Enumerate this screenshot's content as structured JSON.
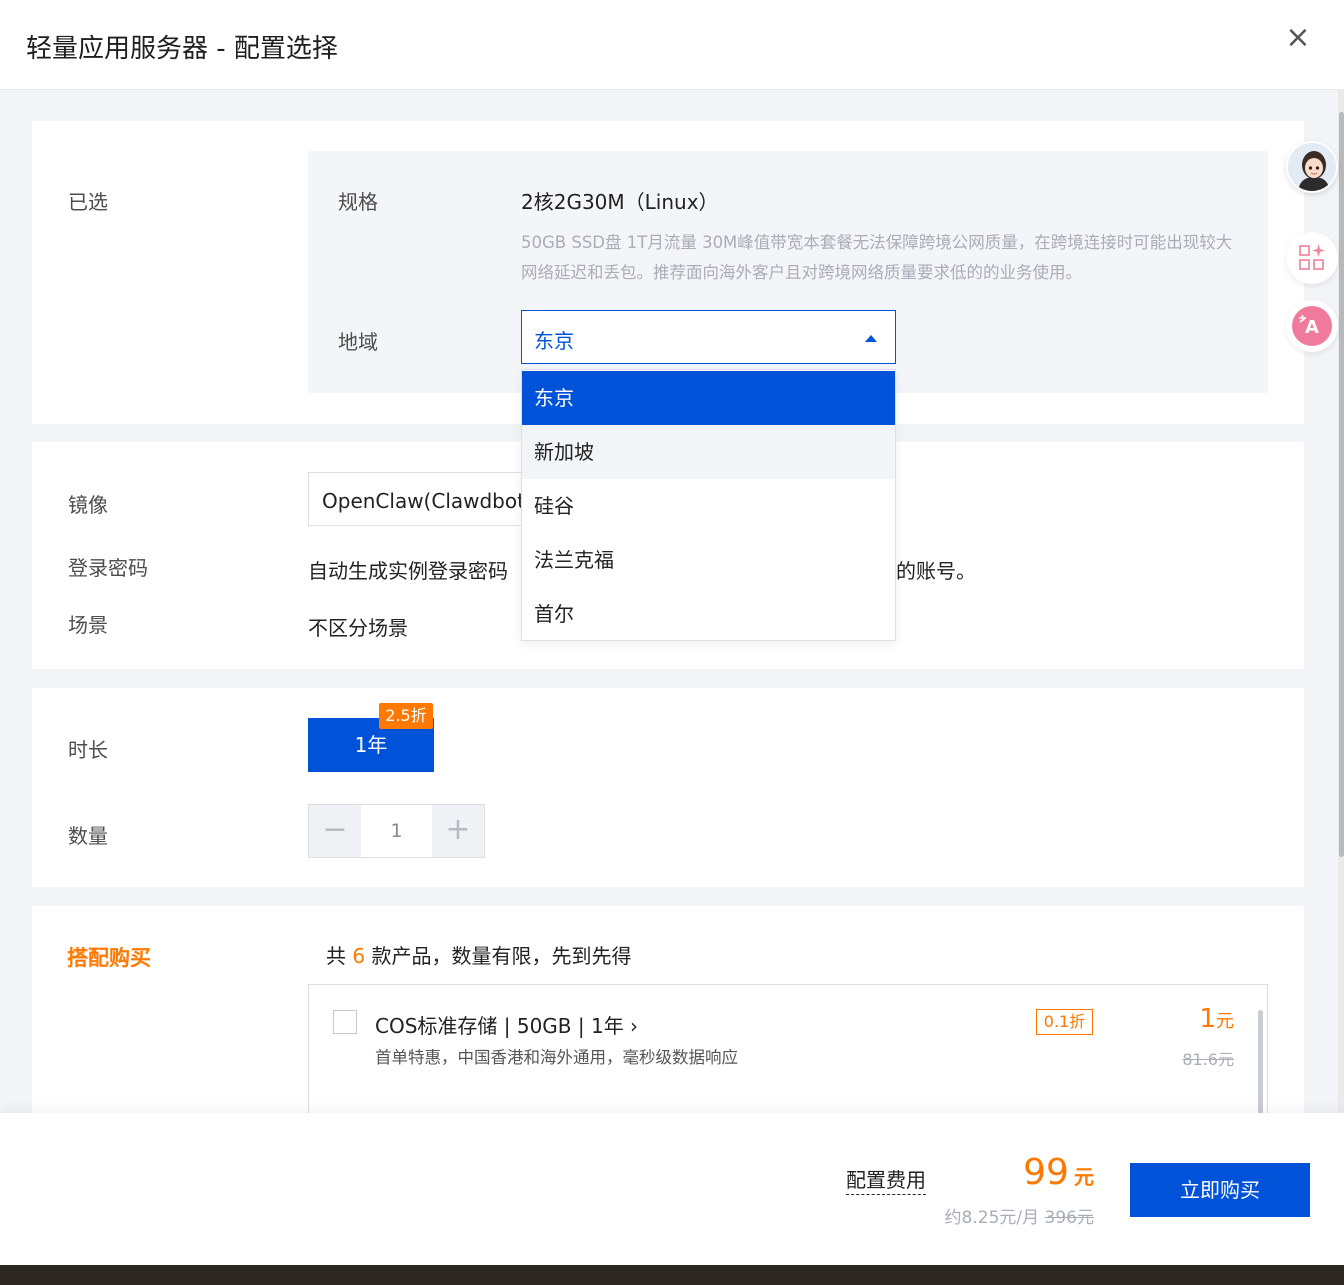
{
  "header": {
    "title": "轻量应用服务器 - 配置选择",
    "close_label": "×"
  },
  "selected": {
    "section_label": "已选",
    "spec_label": "规格",
    "spec_value": "2核2G30M（Linux）",
    "spec_desc": "50GB SSD盘 1T月流量 30M峰值带宽本套餐无法保障跨境公网质量，在跨境连接时可能出现较大网络延迟和丢包。推荐面向海外客户且对跨境网络质量要求低的的业务使用。",
    "region_label": "地域",
    "region_value": "东京",
    "region_options": [
      "东京",
      "新加坡",
      "硅谷",
      "法兰克福",
      "首尔"
    ]
  },
  "image": {
    "label": "镜像",
    "value": "OpenClaw(Clawdbot)",
    "password_label": "登录密码",
    "password_text": "自动生成实例登录密码",
    "password_tail": "的账号。",
    "scene_label": "场景",
    "scene_value": "不区分场景"
  },
  "duration": {
    "label": "时长",
    "value": "1年",
    "badge": "2.5折",
    "qty_label": "数量",
    "qty_value": "1",
    "minus": "−",
    "plus": "+"
  },
  "bundle": {
    "label": "搭配购买",
    "note_prefix": "共",
    "note_count": "6",
    "note_suffix": "款产品，数量有限，先到先得",
    "item": {
      "name": "COS标准存储 | 50GB | 1年 ›",
      "desc": "首单特惠，中国香港和海外通用，毫秒级数据响应",
      "discount": "0.1折",
      "price": "1",
      "price_unit": "元",
      "old_price": "81.6元"
    }
  },
  "footer": {
    "fee_label": "配置费用",
    "total": "99",
    "total_unit": "元",
    "per_month": "约8.25元/月",
    "old_total": "396元",
    "buy_label": "立即购买"
  },
  "colors": {
    "primary": "#0052d9",
    "accent": "#ff7800",
    "muted": "#a8adb8"
  }
}
